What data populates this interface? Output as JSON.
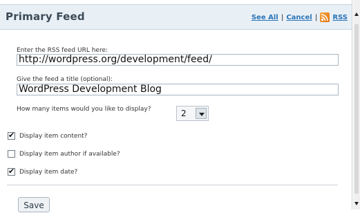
{
  "header": {
    "title": "Primary Feed",
    "links": {
      "see_all": "See All",
      "separator1": "|",
      "cancel": "Cancel",
      "separator2": "|",
      "rss": "RSS"
    },
    "icon": "rss-feed-icon"
  },
  "form": {
    "feed_url": {
      "label": "Enter the RSS feed URL here:",
      "value": "http://wordpress.org/development/feed/"
    },
    "feed_title": {
      "label": "Give the feed a title (optional):",
      "value": "WordPress Development Blog"
    },
    "items_count": {
      "label": "How many items would you like to display?",
      "value": "2"
    },
    "options": [
      {
        "label": "Display item content?",
        "checked": true
      },
      {
        "label": "Display item author if available?",
        "checked": false
      },
      {
        "label": "Display item date?",
        "checked": true
      }
    ],
    "save_label": "Save"
  },
  "colors": {
    "header_bg": "#e8f0f6",
    "link": "#2b74b6",
    "rss_orange": "#e3710f"
  }
}
